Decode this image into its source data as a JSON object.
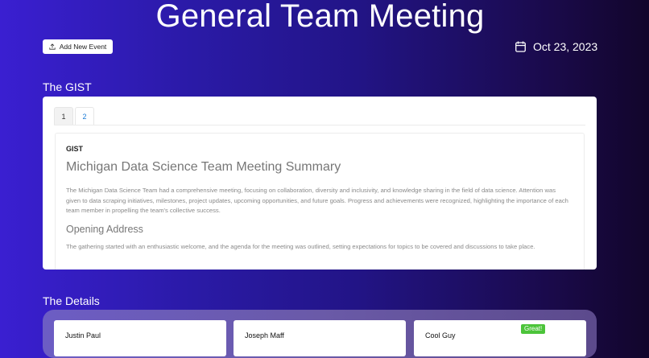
{
  "header": {
    "title": "General Team Meeting",
    "add_event_label": "Add New Event",
    "date": "Oct 23, 2023"
  },
  "gist_section": {
    "heading": "The GIST",
    "tabs": [
      {
        "label": "1",
        "active": false
      },
      {
        "label": "2",
        "active": true
      }
    ],
    "panel_label": "GIST",
    "summary_title": "Michigan Data Science Team Meeting Summary",
    "summary_body": "The Michigan Data Science Team had a comprehensive meeting, focusing on collaboration, diversity and inclusivity, and knowledge sharing in the field of data science. Attention was given to data scraping initiatives, milestones, project updates, upcoming opportunities, and future goals. Progress and achievements were recognized, highlighting the importance of each team member in propelling the team's collective success.",
    "opening_title": "Opening Address",
    "opening_body": "The gathering started with an enthusiastic welcome, and the agenda for the meeting was outlined, setting expectations for topics to be covered and discussions to take place."
  },
  "details_section": {
    "heading": "The Details",
    "people": [
      {
        "name": "Justin Paul"
      },
      {
        "name": "Joseph Maff"
      },
      {
        "name": "Cool Guy",
        "badge": "Great!"
      }
    ]
  },
  "colors": {
    "badge_green": "#4cc43a",
    "active_tab_blue": "#1a7bd6"
  },
  "icons": {
    "add_event": "upload-icon",
    "date": "calendar-icon"
  }
}
